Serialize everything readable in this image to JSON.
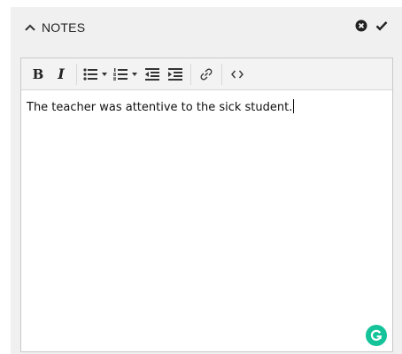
{
  "panel": {
    "title": "NOTES",
    "icons": {
      "collapse": "caret-up-icon",
      "close": "close-circle-icon",
      "confirm": "checkmark-icon"
    }
  },
  "toolbar": {
    "buttons": [
      {
        "name": "bold",
        "label": "B"
      },
      {
        "name": "italic",
        "label": "I"
      },
      {
        "name": "bulleted-list",
        "icon": "bullet-list-icon"
      },
      {
        "name": "numbered-list",
        "icon": "numbered-list-icon"
      },
      {
        "name": "decrease-indent",
        "icon": "outdent-icon"
      },
      {
        "name": "increase-indent",
        "icon": "indent-icon"
      },
      {
        "name": "link",
        "icon": "link-icon"
      },
      {
        "name": "source",
        "icon": "code-icon"
      }
    ]
  },
  "editor": {
    "content": "The teacher was attentive to the sick student."
  },
  "colors": {
    "panel_bg": "#f0f0f0",
    "toolbar_bg": "#f3f3f3",
    "grammarly": "#15c39a"
  }
}
